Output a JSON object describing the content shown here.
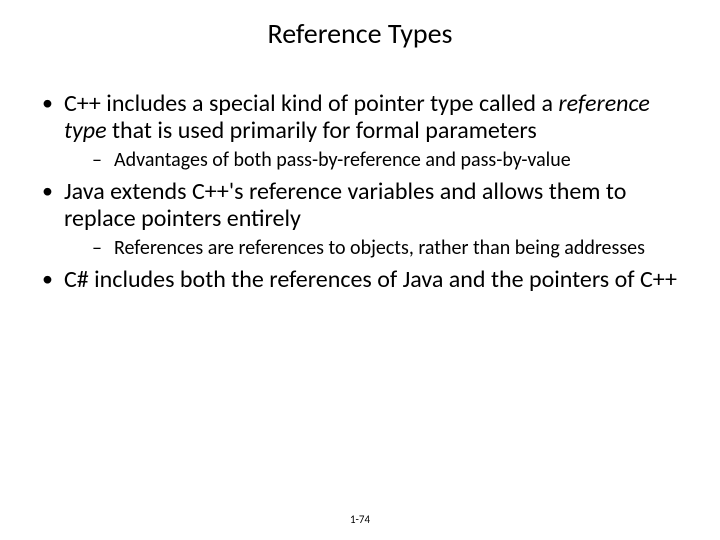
{
  "title": "Reference Types",
  "bullets": [
    {
      "pre": "C++ includes a special kind of pointer type called a ",
      "ital": "reference type",
      "post": " that is used primarily for formal parameters",
      "sub": "Advantages of both pass-by-reference and pass-by-value"
    },
    {
      "pre": "Java extends C++'s reference variables and allows them to replace pointers entirely",
      "ital": "",
      "post": "",
      "sub": "References are references to objects, rather than being addresses"
    },
    {
      "pre": "C# includes both the references of Java and the pointers of C++",
      "ital": "",
      "post": "",
      "sub": ""
    }
  ],
  "page": "1-74"
}
